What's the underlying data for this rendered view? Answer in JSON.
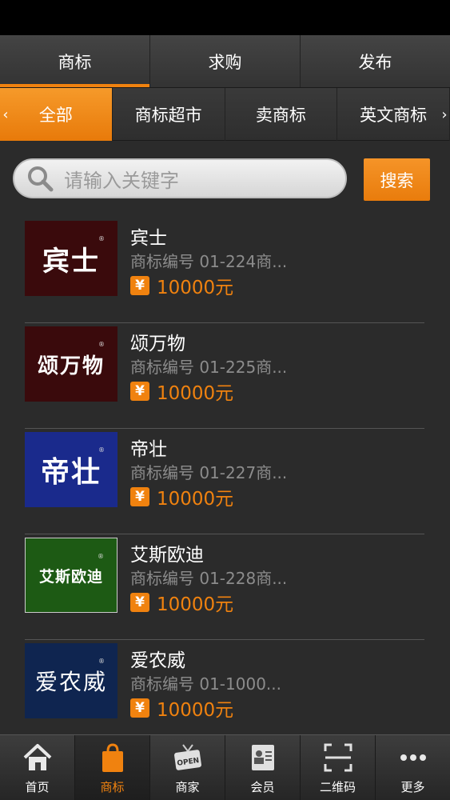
{
  "top_tabs": [
    {
      "label": "商标"
    },
    {
      "label": "求购"
    },
    {
      "label": "发布"
    }
  ],
  "categories": {
    "left_arrow": "‹",
    "right_arrow": "›",
    "items": [
      {
        "label": "全部"
      },
      {
        "label": "商标超市"
      },
      {
        "label": "卖商标"
      },
      {
        "label": "英文商标"
      }
    ]
  },
  "search": {
    "placeholder": "请输入关键字",
    "button_label": "搜索"
  },
  "listings": [
    {
      "name": "宾士",
      "code": "商标编号 01-224商...",
      "currency": "¥",
      "price": "10000元",
      "logo_text": "宾士",
      "logo_bg": "#3a0a0c"
    },
    {
      "name": "颂万物",
      "code": "商标编号 01-225商...",
      "currency": "¥",
      "price": "10000元",
      "logo_text": "颂万物",
      "logo_bg": "#3a0a0c"
    },
    {
      "name": "帝壮",
      "code": "商标编号 01-227商...",
      "currency": "¥",
      "price": "10000元",
      "logo_text": "帝壮",
      "logo_bg": "#1a2a8c"
    },
    {
      "name": "艾斯欧迪",
      "code": "商标编号 01-228商...",
      "currency": "¥",
      "price": "10000元",
      "logo_text": "艾斯欧迪",
      "logo_bg": "#1d5a14"
    },
    {
      "name": "爱农威",
      "code": "商标编号 01-1000...",
      "currency": "¥",
      "price": "10000元",
      "logo_text": "爱农威",
      "logo_bg": "#0f2550"
    }
  ],
  "bottom_nav": [
    {
      "label": "首页",
      "icon": "home-icon"
    },
    {
      "label": "商标",
      "icon": "shopping-bag-icon"
    },
    {
      "label": "商家",
      "icon": "open-sign-icon",
      "icon_text": "OPEN"
    },
    {
      "label": "会员",
      "icon": "member-card-icon"
    },
    {
      "label": "二维码",
      "icon": "qr-scan-icon"
    },
    {
      "label": "更多",
      "icon": "more-icon"
    }
  ],
  "colors": {
    "accent": "#f0820f",
    "background": "#2b2b2b"
  }
}
